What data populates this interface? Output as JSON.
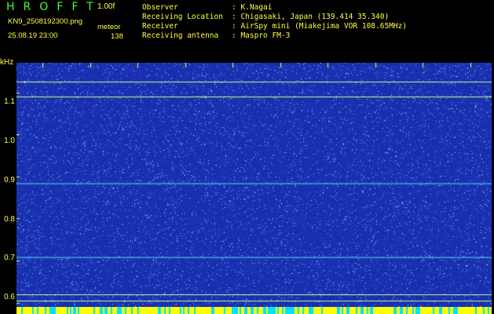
{
  "header": {
    "brand": "HROFFT",
    "version": "1.00f",
    "filename": "KN9_2508192300.png",
    "datetime": "25.08.19 23:00",
    "meteor_label": "meteor",
    "meteor_count": "138"
  },
  "station": [
    {
      "key": "Observer",
      "value": ": K.Nagai"
    },
    {
      "key": "Receiving Location",
      "value": ": Chigasaki, Japan (139.414 35.340)"
    },
    {
      "key": "Receiver",
      "value": ": AirSpy mini (Miakejima VOR 108.65MHz)"
    },
    {
      "key": "Receiving antenna",
      "value": ": Maspro FM-3"
    }
  ],
  "axis": {
    "unit": "kHz",
    "y_ticks": [
      "1.1",
      "1.0",
      "0.9",
      "0.8",
      "0.7",
      "0.6"
    ],
    "x_ticks": [
      "2301",
      "2302",
      "2303",
      "2304",
      "2305",
      "2306",
      "2307",
      "2308",
      "2309",
      "2310"
    ]
  },
  "spectrogram": {
    "freq_range_khz": [
      0.59,
      1.17
    ],
    "horizontal_carrier_lines_khz": [
      1.125,
      1.09,
      0.62,
      0.605
    ],
    "faint_horizontal_lines_khz": [
      0.885,
      0.71
    ],
    "background_color": "#1a2fb0",
    "noise_colors": [
      "#3050d8",
      "#4fa0ff",
      "#5fe8ff",
      "#c8ff80"
    ],
    "marker_color": "#ffff40",
    "strip_colors": [
      "#ffff00",
      "#00e0ff"
    ]
  }
}
